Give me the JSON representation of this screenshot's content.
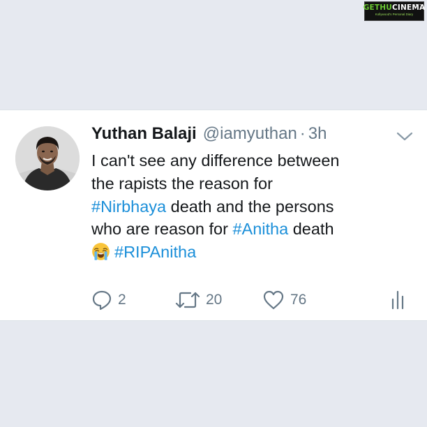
{
  "watermark": {
    "brand_part1": "GETHU",
    "brand_part2": "CINEMA",
    "tagline": "Kollywood's Personal Diary"
  },
  "tweet": {
    "display_name": "Yuthan Balaji",
    "handle": "@iamyuthan",
    "separator": "·",
    "timestamp": "3h",
    "text": {
      "line1": "I can't see any difference between",
      "line2": "the rapists the reason for",
      "hashtag_nirbhaya": "#Nirbhaya",
      "line3_rest": " death and the persons",
      "line4_start": "who are reason for ",
      "hashtag_anitha": "#Anitha",
      "line4_end": " death",
      "hashtag_ripanitha": "#RIPAnitha"
    },
    "emoji_name": "loudly-crying-face",
    "actions": {
      "reply_count": "2",
      "retweet_count": "20",
      "like_count": "76"
    }
  },
  "colors": {
    "background": "#e6e9f0",
    "card": "#ffffff",
    "text": "#14171a",
    "secondary": "#657786",
    "hashtag": "#1b8fd9"
  }
}
